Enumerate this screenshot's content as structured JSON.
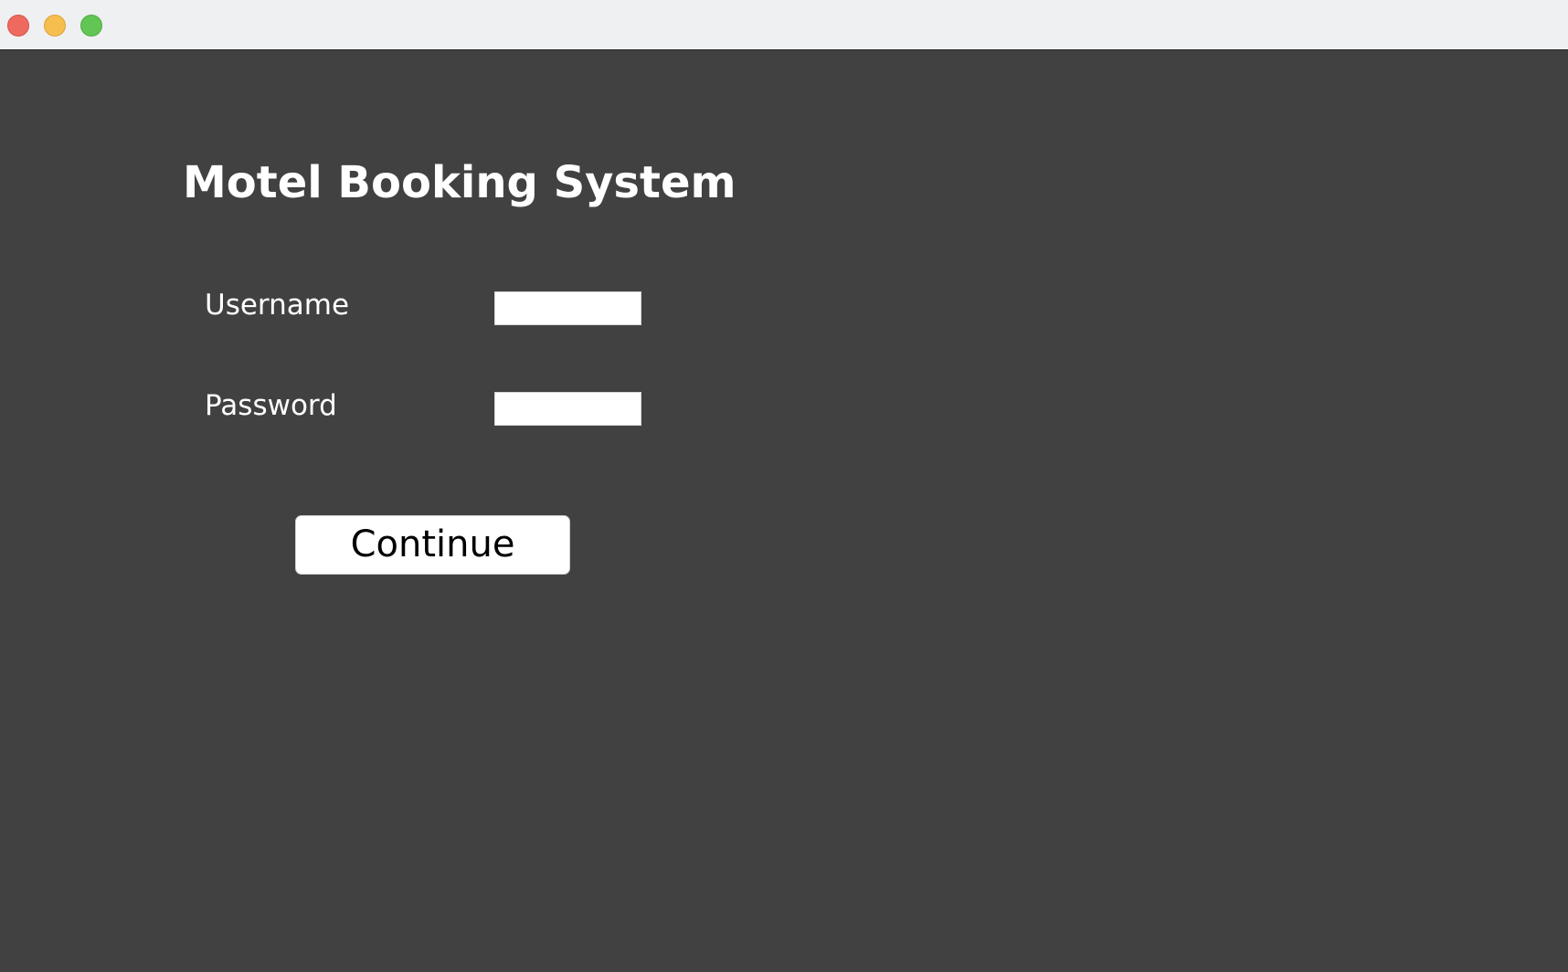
{
  "window": {
    "controls": {
      "close": "close-icon",
      "minimize": "minimize-icon",
      "maximize": "maximize-icon"
    },
    "colors": {
      "background": "#414141",
      "titlebar": "#eff0f2",
      "text": "#ffffff",
      "close": "#ee6a5f",
      "minimize": "#f5be4f",
      "maximize": "#62c554"
    }
  },
  "login": {
    "title": "Motel Booking System",
    "username_label": "Username",
    "username_value": "",
    "password_label": "Password",
    "password_value": "",
    "continue_label": "Continue"
  }
}
